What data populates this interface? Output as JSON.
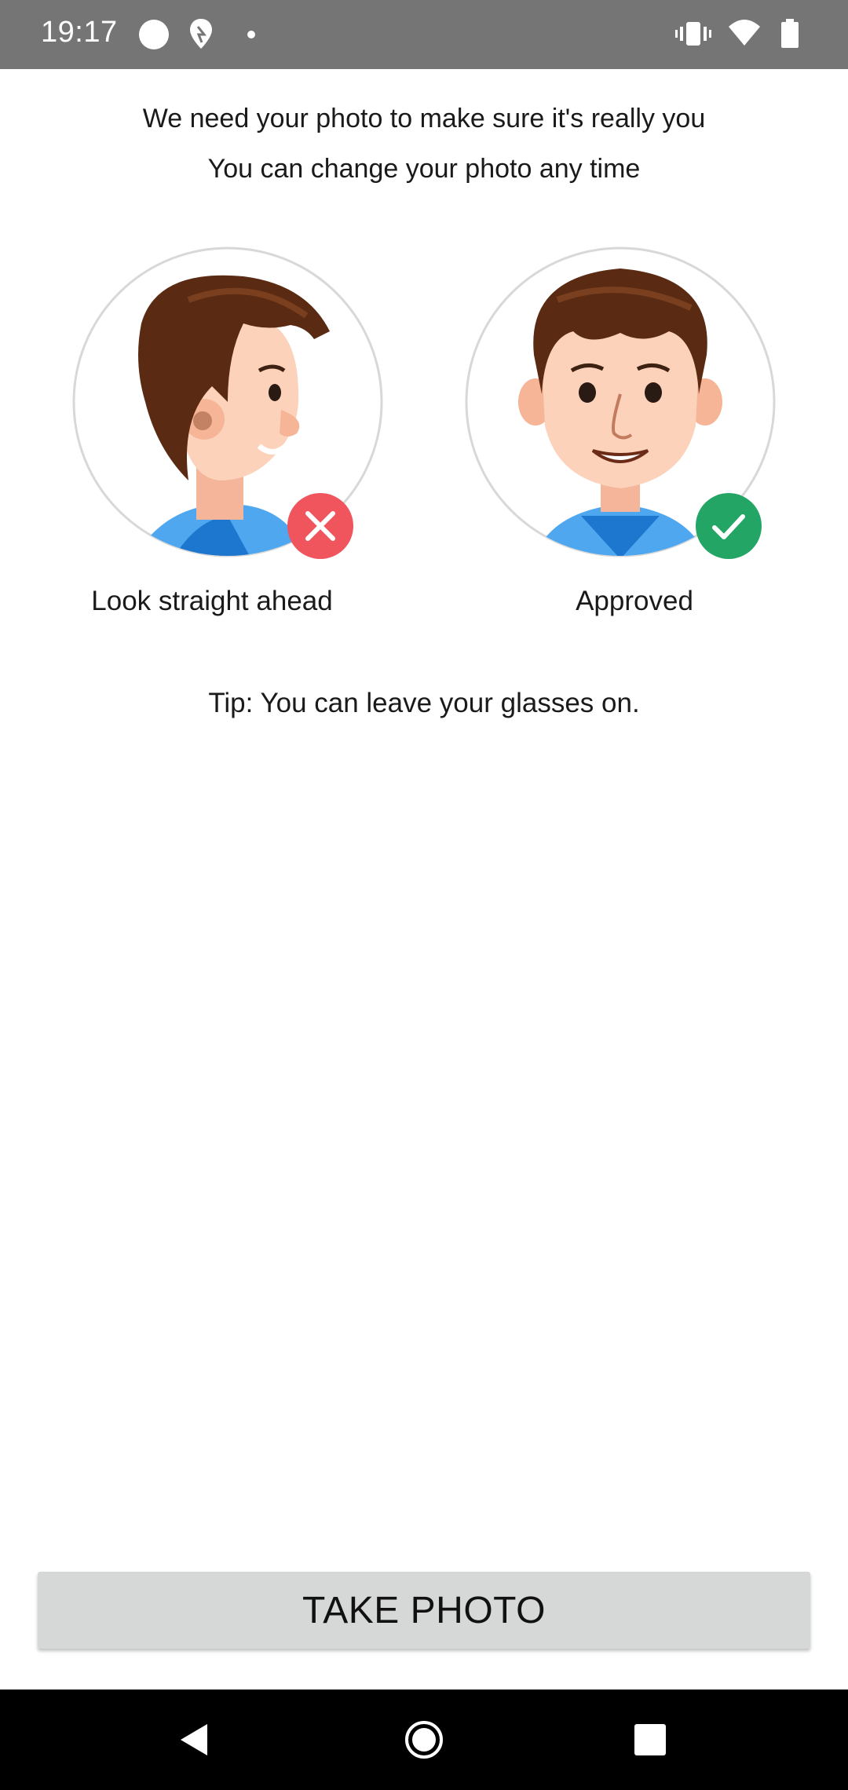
{
  "status_bar": {
    "time": "19:17",
    "left_icons": [
      "circle-icon",
      "location-pin-icon",
      "dot-icon"
    ],
    "right_icons": [
      "vibrate-icon",
      "wifi-icon",
      "battery-icon"
    ]
  },
  "intro": {
    "line1": "We need your photo to make sure it's really you",
    "line2": "You can change your photo any time"
  },
  "examples": {
    "bad": {
      "caption": "Look straight ahead",
      "status": "rejected",
      "badge_color": "#f0555d"
    },
    "good": {
      "caption": "Approved",
      "status": "approved",
      "badge_color": "#22a565"
    }
  },
  "tip": "Tip: You can leave your glasses on.",
  "take_photo_button": "TAKE PHOTO",
  "nav_bar": {
    "icons": [
      "back-icon",
      "home-icon",
      "recents-icon"
    ]
  }
}
